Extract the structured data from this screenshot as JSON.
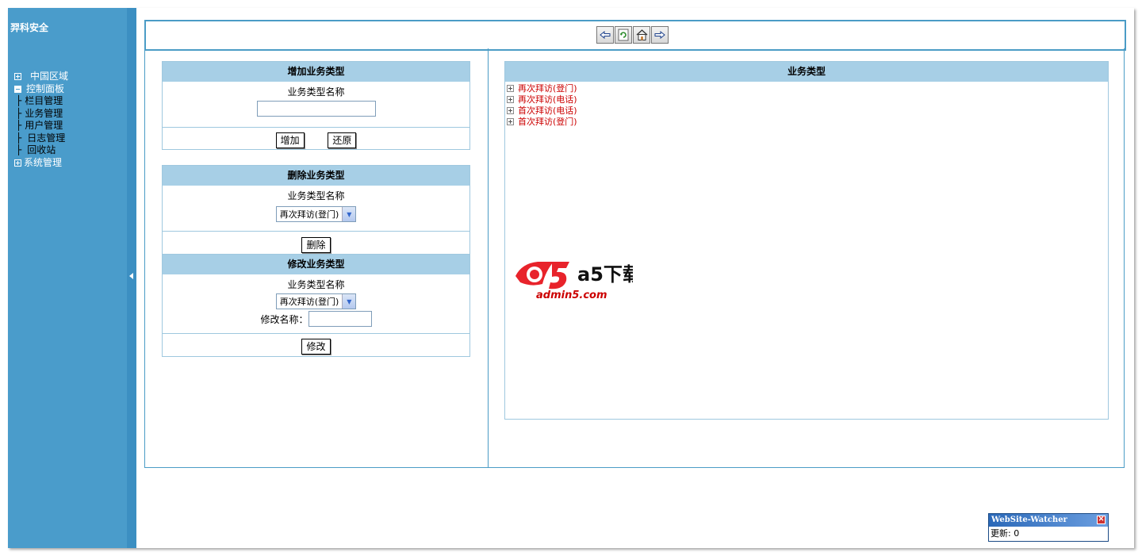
{
  "sidebar": {
    "brand": "羿科安全",
    "tree": [
      {
        "label": "中国区域",
        "state": "collapsed"
      },
      {
        "label": "控制面板",
        "state": "expanded",
        "children": [
          "栏目管理",
          "业务管理",
          "用户管理",
          "日志管理",
          "回收站"
        ]
      },
      {
        "label": "系统管理",
        "state": "collapsed"
      }
    ],
    "branch_glyph": "├"
  },
  "toolbar": {
    "back_icon": "back-arrow-icon",
    "refresh_icon": "refresh-icon",
    "home_icon": "home-icon",
    "forward_icon": "forward-arrow-icon"
  },
  "add_panel": {
    "title": "增加业务类型",
    "field_label": "业务类型名称",
    "name_value": "",
    "add_label": "增加",
    "reset_label": "还原"
  },
  "delete_panel": {
    "title": "删除业务类型",
    "field_label": "业务类型名称",
    "selected": "再次拜访(登门)",
    "delete_label": "删除"
  },
  "modify_panel": {
    "title": "修改业务类型",
    "field_label": "业务类型名称",
    "selected": "再次拜访(登门)",
    "rename_label": "修改名称：",
    "rename_value": "",
    "modify_label": "修改"
  },
  "type_list": {
    "title": "业务类型",
    "items": [
      "再次拜访(登门)",
      "再次拜访(电话)",
      "首次拜访(电话)",
      "首次拜访(登门)"
    ]
  },
  "watermark": {
    "brand": "a5下载",
    "site": "admin5.com"
  },
  "watcher": {
    "title": "WebSite-Watcher",
    "update_text": "更新: 0"
  },
  "colors": {
    "sidebar": "#4a9ccb",
    "panel_border": "#4b9cc6",
    "panel_header": "#a7cfe6",
    "list_text": "#cc0000"
  }
}
